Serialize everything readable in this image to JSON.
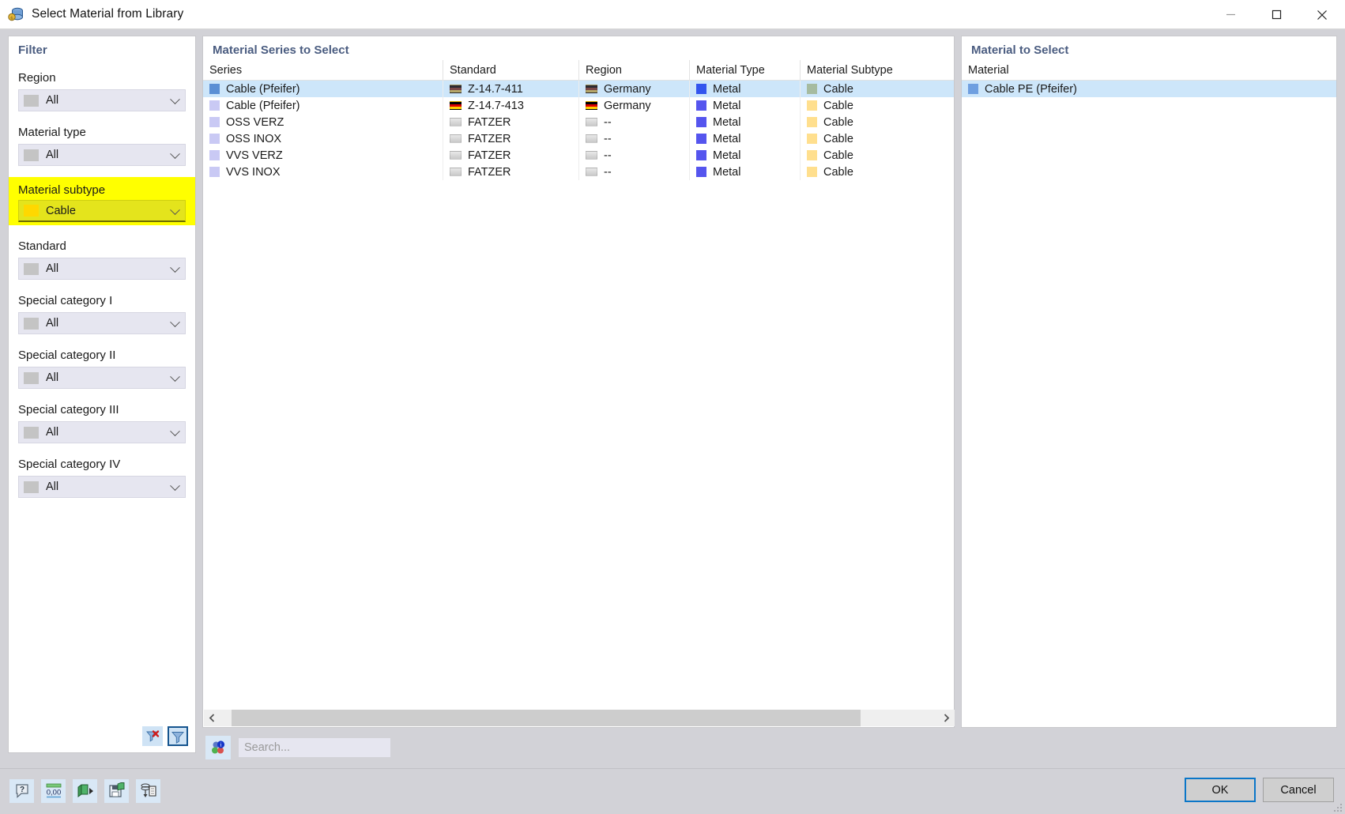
{
  "window": {
    "title": "Select Material from Library",
    "icon": "library-cylinder-icon",
    "minimize": "minimize-icon",
    "maximize": "maximize-icon",
    "close": "close-icon"
  },
  "filter": {
    "title": "Filter",
    "groups": [
      {
        "label": "Region",
        "value": "All",
        "highlighted": false
      },
      {
        "label": "Material type",
        "value": "All",
        "highlighted": false
      },
      {
        "label": "Material subtype",
        "value": "Cable",
        "highlighted": true
      },
      {
        "label": "Standard",
        "value": "All",
        "highlighted": false
      },
      {
        "label": "Special category I",
        "value": "All",
        "highlighted": false
      },
      {
        "label": "Special category II",
        "value": "All",
        "highlighted": false
      },
      {
        "label": "Special category III",
        "value": "All",
        "highlighted": false
      },
      {
        "label": "Special category IV",
        "value": "All",
        "highlighted": false
      }
    ],
    "actions": [
      {
        "name": "clear-filter-button",
        "icon": "funnel-clear-icon",
        "active": false
      },
      {
        "name": "apply-filter-button",
        "icon": "funnel-apply-icon",
        "active": true
      }
    ]
  },
  "series_panel": {
    "title": "Material Series to Select",
    "columns": [
      "Series",
      "Standard",
      "Region",
      "Material Type",
      "Material Subtype"
    ],
    "rows": [
      {
        "series": "Cable (Pfeifer)",
        "standard": "Z-14.7-411",
        "region": "Germany",
        "material_type": "Metal",
        "material_subtype": "Cable",
        "series_color": "#5b8fd4",
        "region_flag": "germany-dim",
        "type_color": "#3355ee",
        "subtype_color": "#a6bba0",
        "selected": true
      },
      {
        "series": "Cable (Pfeifer)",
        "standard": "Z-14.7-413",
        "region": "Germany",
        "material_type": "Metal",
        "material_subtype": "Cable",
        "series_color": "#c9c9f4",
        "region_flag": "germany",
        "type_color": "#5555ee",
        "subtype_color": "#ffdf8e",
        "selected": false
      },
      {
        "series": "OSS VERZ",
        "standard": "FATZER",
        "region": "--",
        "material_type": "Metal",
        "material_subtype": "Cable",
        "series_color": "#c9c9f4",
        "region_flag": "none",
        "type_color": "#5555ee",
        "subtype_color": "#ffdf8e",
        "selected": false
      },
      {
        "series": "OSS INOX",
        "standard": "FATZER",
        "region": "--",
        "material_type": "Metal",
        "material_subtype": "Cable",
        "series_color": "#c9c9f4",
        "region_flag": "none",
        "type_color": "#5555ee",
        "subtype_color": "#ffdf8e",
        "selected": false
      },
      {
        "series": "VVS VERZ",
        "standard": "FATZER",
        "region": "--",
        "material_type": "Metal",
        "material_subtype": "Cable",
        "series_color": "#c9c9f4",
        "region_flag": "none",
        "type_color": "#5555ee",
        "subtype_color": "#ffdf8e",
        "selected": false
      },
      {
        "series": "VVS INOX",
        "standard": "FATZER",
        "region": "--",
        "material_type": "Metal",
        "material_subtype": "Cable",
        "series_color": "#c9c9f4",
        "region_flag": "none",
        "type_color": "#5555ee",
        "subtype_color": "#ffdf8e",
        "selected": false
      }
    ],
    "scrollbar": {
      "left_arrow": "chevron-left-icon",
      "right_arrow": "chevron-right-icon"
    }
  },
  "material_panel": {
    "title": "Material to Select",
    "columns": [
      "Material"
    ],
    "rows": [
      {
        "material": "Cable PE (Pfeifer)",
        "color": "#6f9fe0",
        "selected": true
      }
    ]
  },
  "search": {
    "placeholder": "Search...",
    "value": "",
    "icon": "search-balls-info-icon"
  },
  "toolbar": {
    "icons": [
      {
        "name": "help-info-icon",
        "label": "?"
      },
      {
        "name": "numeric-format-icon",
        "label": "0,00"
      },
      {
        "name": "export-db-icon",
        "label": ""
      },
      {
        "name": "save-db-icon",
        "label": ""
      },
      {
        "name": "import-list-icon",
        "label": ""
      }
    ]
  },
  "buttons": {
    "ok": "OK",
    "cancel": "Cancel"
  },
  "colors": {
    "accent": "#0a76c8",
    "panel_title": "#4a5c80",
    "selection": "#cde6fa",
    "highlight": "#ffff00",
    "window_bg": "#d2d2d7"
  }
}
